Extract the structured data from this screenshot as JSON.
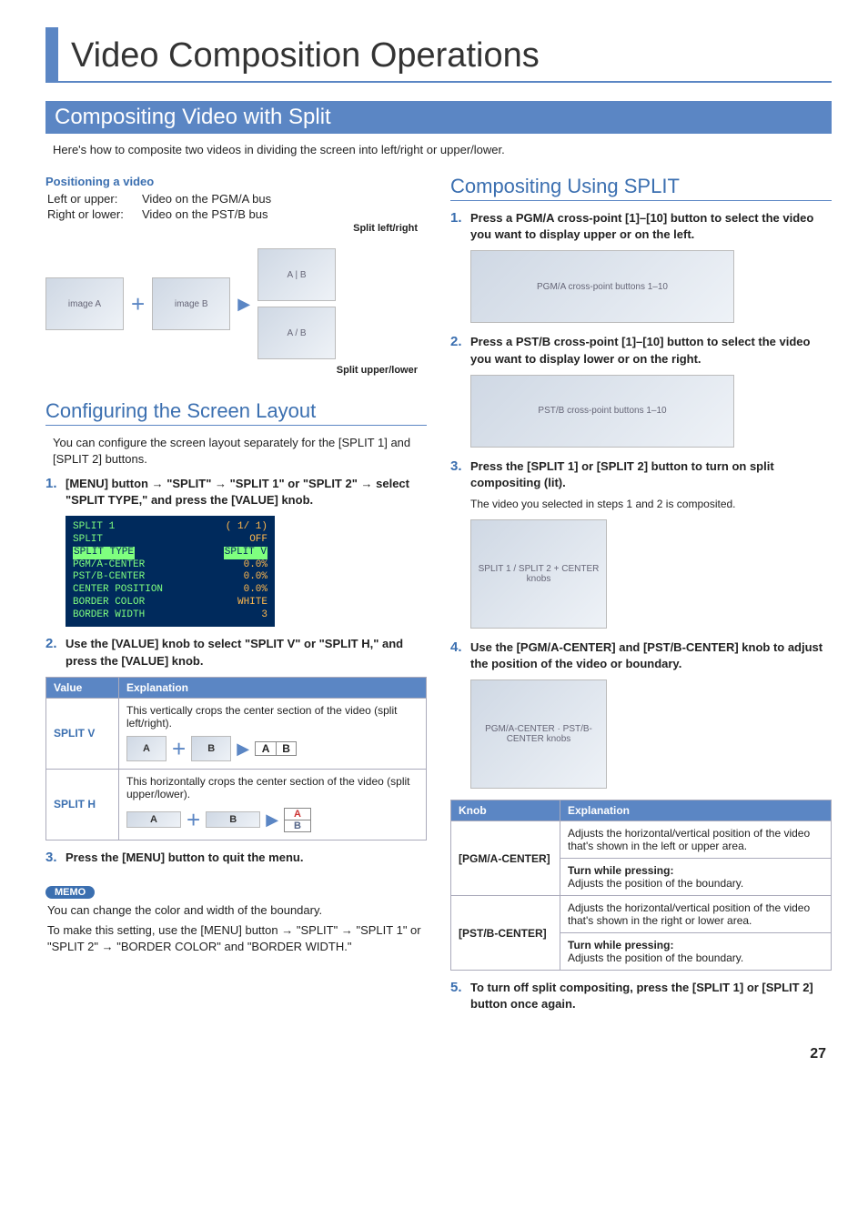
{
  "chapter_title": "Video Composition Operations",
  "section_title": "Compositing Video with Split",
  "intro": "Here's how to composite two videos in dividing the screen into left/right or upper/lower.",
  "left": {
    "positioning_head": "Positioning a video",
    "rows": [
      {
        "k": "Left or upper:",
        "v": "Video on the PGM/A bus"
      },
      {
        "k": "Right or lower:",
        "v": "Video on the PST/B bus"
      }
    ],
    "illus": {
      "a": "image A",
      "b": "image B",
      "split_lr": "Split left/right",
      "split_ul": "Split upper/lower"
    },
    "config_head": "Configuring the Screen Layout",
    "config_intro": "You can configure the screen layout separately for the [SPLIT 1] and [SPLIT 2] buttons.",
    "step1_pre": "[MENU] button ",
    "step1_a": "\"SPLIT\"",
    "step1_b": "\"SPLIT 1\" or \"SPLIT 2\"",
    "step1_post": "select \"SPLIT TYPE,\" and press the [VALUE] knob.",
    "lcd": {
      "title": "SPLIT 1",
      "page": "( 1/ 1)",
      "r1k": "SPLIT",
      "r1v": "OFF",
      "r2k": "SPLIT TYPE",
      "r2v": "SPLIT V",
      "r3k": "PGM/A-CENTER",
      "r3v": "0.0%",
      "r4k": "PST/B-CENTER",
      "r4v": "0.0%",
      "r5k": "CENTER POSITION",
      "r5v": "0.0%",
      "r6k": "BORDER COLOR",
      "r6v": "WHITE",
      "r7k": "BORDER WIDTH",
      "r7v": "3"
    },
    "step2": "Use the [VALUE] knob to select \"SPLIT V\" or \"SPLIT H,\" and press the [VALUE] knob.",
    "table": {
      "h1": "Value",
      "h2": "Explanation",
      "v1": "SPLIT V",
      "e1": "This vertically crops the center section of the video (split left/right).",
      "v2": "SPLIT H",
      "e2": "This horizontally crops the center section of the video (split upper/lower)."
    },
    "step3": "Press the [MENU] button to quit the menu.",
    "memo_label": "MEMO",
    "memo1": "You can change the color and width of the boundary.",
    "memo2_a": "To make this setting, use the [MENU] button ",
    "memo2_b": "\"SPLIT\"",
    "memo2_c": "\"SPLIT 1\" or \"SPLIT 2\"",
    "memo2_d": "\"BORDER COLOR\" and \"BORDER WIDTH.\""
  },
  "right": {
    "head": "Compositing Using SPLIT",
    "step1": "Press a PGM/A cross-point [1]–[10] button to select the video you want to display upper or on the left.",
    "step2": "Press a PST/B cross-point [1]–[10] button to select the video you want to display lower or on the right.",
    "step3": "Press the [SPLIT 1] or [SPLIT 2] button to turn on split compositing (lit).",
    "step3_sub": "The video you selected in steps 1 and 2 is composited.",
    "step4": "Use the [PGM/A-CENTER] and [PST/B-CENTER] knob to adjust the position of the video or boundary.",
    "table": {
      "h1": "Knob",
      "h2": "Explanation",
      "k1": "[PGM/A-CENTER]",
      "e1": "Adjusts the horizontal/vertical position of the video that's shown in the left or upper area.",
      "t1a": "Turn while pressing:",
      "t1b": "Adjusts the position of the boundary.",
      "k2": "[PST/B-CENTER]",
      "e2": "Adjusts the horizontal/vertical position of the video that's shown in the right or lower area.",
      "t2a": "Turn while pressing:",
      "t2b": "Adjusts the position of the boundary."
    },
    "step5": "To turn off split compositing, press the [SPLIT 1] or [SPLIT 2] button once again."
  },
  "page_num": "27",
  "glyphs": {
    "A": "A",
    "B": "B"
  }
}
